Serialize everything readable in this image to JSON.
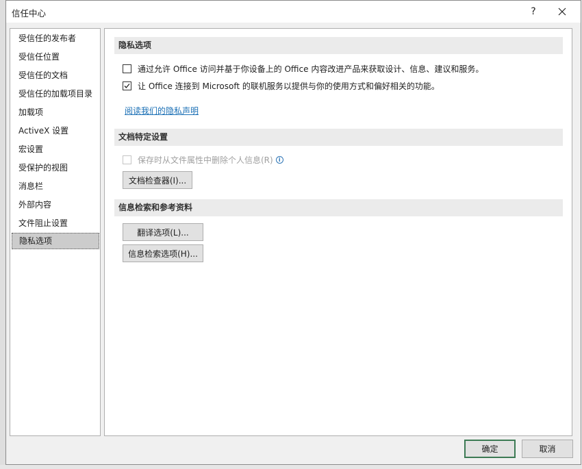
{
  "window": {
    "title": "信任中心",
    "help_label": "?"
  },
  "nav": {
    "items": [
      {
        "label": "受信任的发布者"
      },
      {
        "label": "受信任位置"
      },
      {
        "label": "受信任的文档"
      },
      {
        "label": "受信任的加载项目录"
      },
      {
        "label": "加载项"
      },
      {
        "label": "ActiveX 设置"
      },
      {
        "label": "宏设置"
      },
      {
        "label": "受保护的视图"
      },
      {
        "label": "消息栏"
      },
      {
        "label": "外部内容"
      },
      {
        "label": "文件阻止设置"
      },
      {
        "label": "隐私选项",
        "selected": true
      }
    ]
  },
  "privacy": {
    "header": "隐私选项",
    "option1": {
      "label": "通过允许 Office 访问并基于你设备上的 Office 内容改进产品来获取设计、信息、建议和服务。",
      "checked": false
    },
    "option2": {
      "label": "让 Office 连接到 Microsoft 的联机服务以提供与你的使用方式和偏好相关的功能。",
      "checked": true
    },
    "link": "阅读我们的隐私声明"
  },
  "document": {
    "header": "文档特定设置",
    "option": {
      "label": "保存时从文件属性中删除个人信息(R)",
      "checked": false,
      "enabled": false
    },
    "inspector_button": "文档检查器(I)..."
  },
  "research": {
    "header": "信息检索和参考资料",
    "translate_button": "翻译选项(L)...",
    "research_button": "信息检索选项(H)..."
  },
  "footer": {
    "ok": "确定",
    "cancel": "取消"
  },
  "colors": {
    "link": "#1a6fb5",
    "default_button_border": "#3c7a54",
    "selected_nav": "#cccccc"
  }
}
